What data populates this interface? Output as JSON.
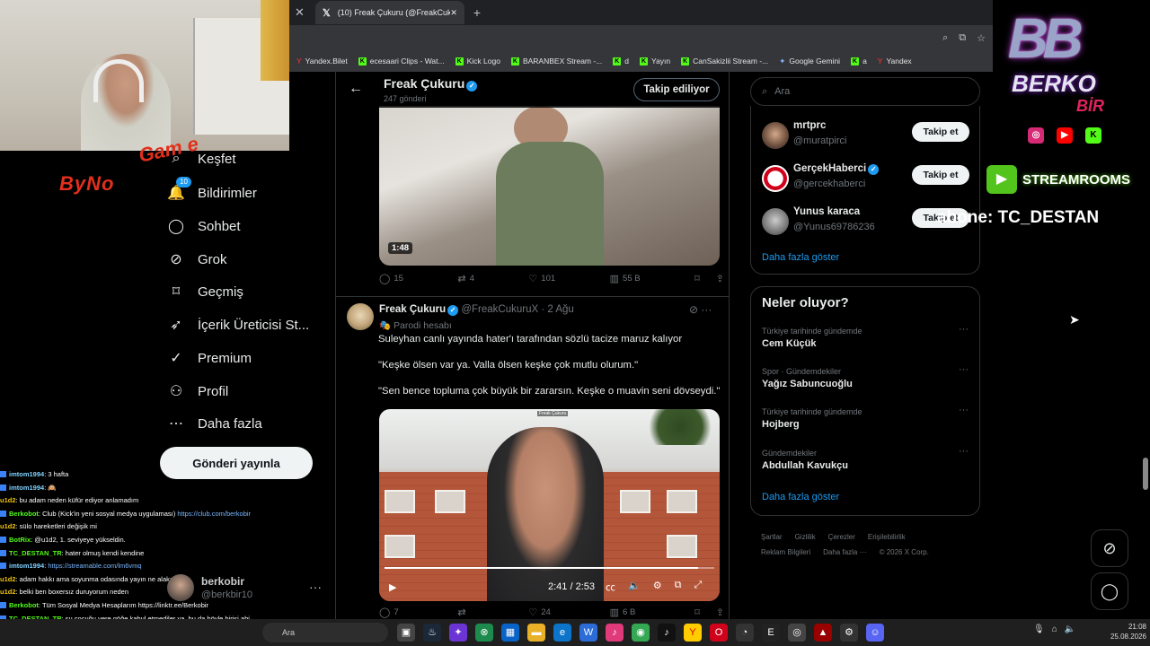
{
  "browser": {
    "tab_title": "(10) Freak Çukuru (@FreakCuku",
    "bookmarks": [
      "Yandex.Bilet",
      "ecesaari Clips - Wat...",
      "Kick Logo",
      "BARANBEX Stream -...",
      "d",
      "Yayın",
      "CanSakizlii Stream -...",
      "Google Gemini",
      "a",
      "Yandex"
    ]
  },
  "nav": {
    "items": [
      {
        "label": "Keşfet",
        "icon": "search-icon"
      },
      {
        "label": "Bildirimler",
        "icon": "bell-icon",
        "badge": "10"
      },
      {
        "label": "Sohbet",
        "icon": "chat-icon"
      },
      {
        "label": "Grok",
        "icon": "grok-icon"
      },
      {
        "label": "Geçmiş",
        "icon": "bookmark-icon"
      },
      {
        "label": "İçerik Üreticisi St...",
        "icon": "rocket-icon"
      },
      {
        "label": "Premium",
        "icon": "verified-icon"
      },
      {
        "label": "Profil",
        "icon": "user-icon"
      },
      {
        "label": "Daha fazla",
        "icon": "more-circle-icon"
      }
    ],
    "post_button": "Gönderi yayınla",
    "account": {
      "name": "berkobir",
      "handle": "@berkbir10"
    }
  },
  "overlay": {
    "byno_left": "ByNo",
    "byno_right": "Gam e",
    "berko_logo": "BB",
    "berko_word1": "BERKO",
    "berko_word2": "BİR",
    "streamrooms": "STREAMROOMS",
    "abone": "abone: TC_DESTAN"
  },
  "chat": [
    {
      "user": "imtom1994",
      "msg": ": 3 hafta",
      "color": "#7fd1ff",
      "mark": true
    },
    {
      "user": "imtom1994",
      "msg": ": 🙉",
      "color": "#7fd1ff",
      "mark": true
    },
    {
      "user": "u1d2",
      "msg": ": bu adam neden küfür ediyor anlamadım",
      "color": "#f1c40f",
      "mark": false
    },
    {
      "user": "Berkobot",
      "msg": ": Club (Kick'in yeni sosyal medya uygulaması)",
      "link": "https://club.com/berkobir",
      "color": "#53fc18",
      "mark": true
    },
    {
      "user": "u1d2",
      "msg": ": sülo hareketleri değişik mi",
      "color": "#f1c40f",
      "mark": false
    },
    {
      "user": "BotRix",
      "msg": ": @u1d2, 1. seviyeye yükseldin.",
      "color": "#53fc18",
      "mark": true
    },
    {
      "user": "TC_DESTAN_TR",
      "msg": ": hater olmuş kendi kendine",
      "color": "#53fc18",
      "mark": true
    },
    {
      "user": "imtom1994",
      "msg": ":",
      "link": "https://streamable.com/lm6vmq",
      "color": "#7fd1ff",
      "mark": true
    },
    {
      "user": "u1d2",
      "msg": ": adam hakkı ama soyunma odasında yayın ne alaka",
      "color": "#f1c40f",
      "mark": false
    },
    {
      "user": "u1d2",
      "msg": ": belki ben boxersız duruyorum neden",
      "color": "#f1c40f",
      "mark": false
    },
    {
      "user": "Berkobot",
      "msg": ": Tüm Sosyal Medya Hesaplarım https://linktr.ee/Berkobir",
      "color": "#53fc18",
      "mark": true
    },
    {
      "user": "TC_DESTAN_TR",
      "msg": ": şu çocuğu yere göğe kabul etmediler ya, bu da böyle birisi abi,",
      "color": "#53fc18",
      "mark": true
    },
    {
      "user": "",
      "msg": "özel olduğunu anlıyorsunuz, biraz anlayışlı olsunlar",
      "color": "#fff",
      "mark": false
    }
  ],
  "profile": {
    "name": "Freak Çukuru",
    "posts_count": "247 gönderi",
    "follow_state": "Takip ediliyor"
  },
  "tweet1": {
    "video_duration": "1:48",
    "replies": "15",
    "reposts": "4",
    "likes": "101",
    "views": "55 B"
  },
  "tweet2": {
    "name": "Freak Çukuru",
    "handle": "@FreakCukuruX",
    "date": "2 Ağu",
    "parody": "Parodi hesabı",
    "paragraphs": [
      "Suleyhan canlı yayında hater'ı tarafından sözlü tacize maruz kalıyor",
      "\"Keşke ölsen var ya. Valla ölsen keşke çok mutlu olurum.\"",
      "\"Sen bence topluma çok büyük bir zararsın. Keşke o muavin seni dövseydi.\""
    ],
    "video_watermark": "Freak Çukuru",
    "video_time": "2:41 / 2:53",
    "video_progress": 0.95,
    "replies": "7",
    "reposts": "",
    "likes": "24",
    "views": "6 B"
  },
  "search": {
    "placeholder": "Ara"
  },
  "suggestions": [
    {
      "name": "mrtprc",
      "handle": "@muratpirci",
      "button": "Takip et",
      "verified": false
    },
    {
      "name": "GerçekHaberci",
      "handle": "@gercekhaberci",
      "button": "Takip et",
      "verified": true
    },
    {
      "name": "Yunus karaca",
      "handle": "@Yunus69786236",
      "button": "Takip et",
      "verified": false
    }
  ],
  "suggestions_more": "Daha fazla göster",
  "trends": {
    "title": "Neler oluyor?",
    "items": [
      {
        "context": "Türkiye tarihinde gündemde",
        "name": "Cem Küçük"
      },
      {
        "context": "Spor · Gündemdekiler",
        "name": "Yağız Sabuncuoğlu"
      },
      {
        "context": "Türkiye tarihinde gündemde",
        "name": "Hojberg"
      },
      {
        "context": "Gündemdekiler",
        "name": "Abdullah Kavukçu"
      }
    ],
    "more": "Daha fazla göster"
  },
  "footer": [
    "Şartlar",
    "Gizlilik",
    "Çerezler",
    "Erişilebilirlik",
    "Reklam Bilgileri",
    "Daha fazla ···",
    "© 2026 X Corp."
  ],
  "taskbar": {
    "search": "Ara",
    "time": "21:08",
    "date": "25.08.2026"
  }
}
